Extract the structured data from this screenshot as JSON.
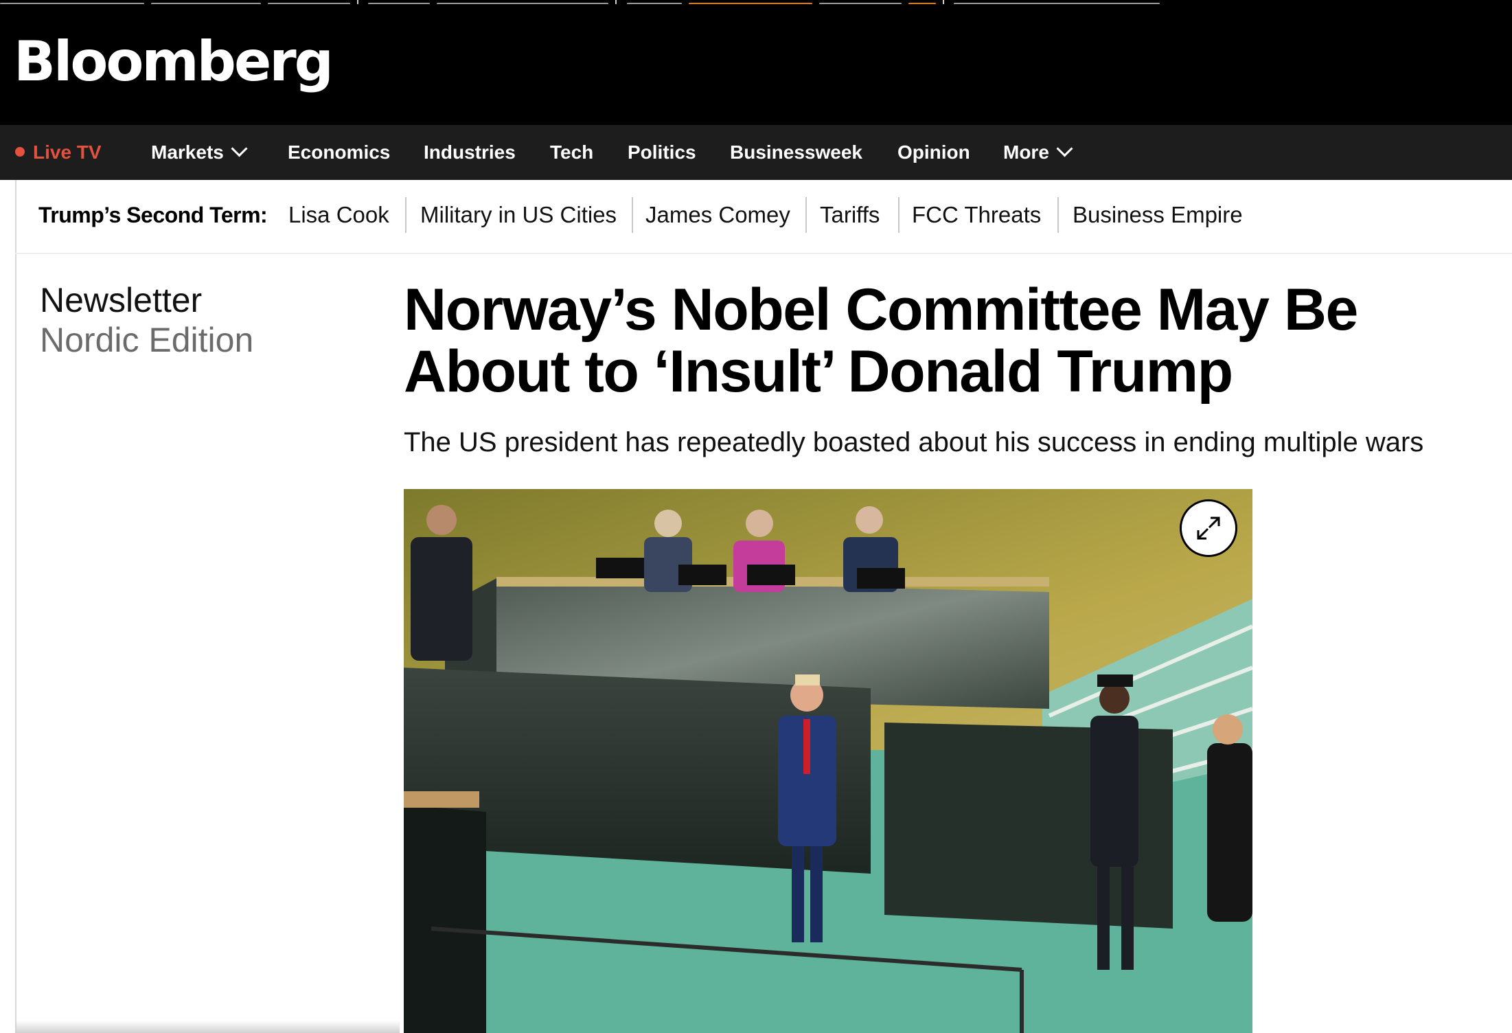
{
  "brand": {
    "logo_text": "Bloomberg"
  },
  "nav": {
    "live_tv": "Live TV",
    "items": [
      {
        "label": "Markets",
        "has_dropdown": true
      },
      {
        "label": "Economics",
        "has_dropdown": false
      },
      {
        "label": "Industries",
        "has_dropdown": false
      },
      {
        "label": "Tech",
        "has_dropdown": false
      },
      {
        "label": "Politics",
        "has_dropdown": false
      },
      {
        "label": "Businessweek",
        "has_dropdown": false
      },
      {
        "label": "Opinion",
        "has_dropdown": false
      },
      {
        "label": "More",
        "has_dropdown": true
      }
    ]
  },
  "topics": {
    "label": "Trump’s Second Term:",
    "items": [
      "Lisa Cook",
      "Military in US Cities",
      "James Comey",
      "Tariffs",
      "FCC Threats",
      "Business Empire"
    ]
  },
  "newsletter": {
    "title": "Newsletter",
    "edition": "Nordic Edition"
  },
  "article": {
    "headline_line1": "Norway’s Nobel Committee May Be",
    "headline_line2": "About to ‘Insult’ Donald Trump",
    "dek": "The US president has repeatedly boasted about his success in ending multiple wars"
  },
  "icons": {
    "expand": "expand-icon",
    "live_dot": "live-dot-icon",
    "chevron": "chevron-down-icon"
  },
  "colors": {
    "masthead": "#000000",
    "navbar": "#1d1d1d",
    "live_accent": "#e2523f"
  }
}
